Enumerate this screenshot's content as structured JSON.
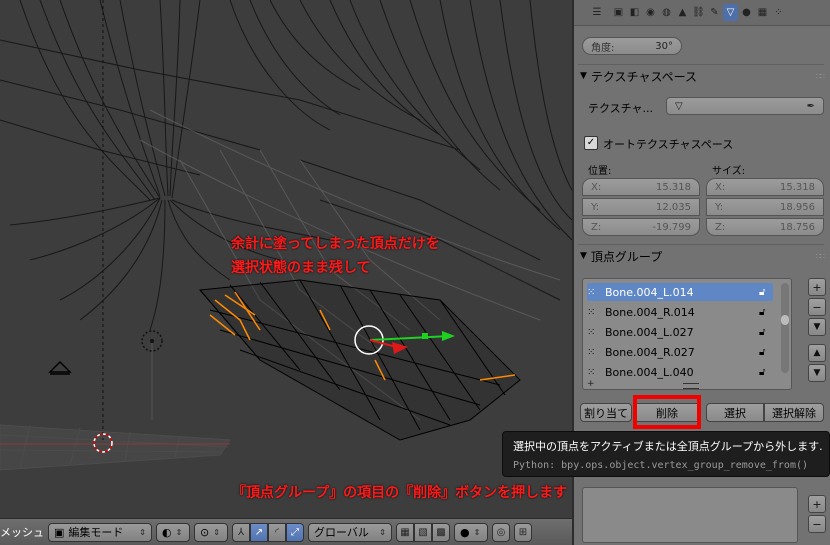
{
  "viewport": {
    "annotation_top_line1": "余計に塗ってしまった頂点だけを",
    "annotation_top_line2": "選択状態のまま残して",
    "annotation_bottom": "『頂点グループ』の項目の『削除』ボタンを押します"
  },
  "header": {
    "mesh_label": "メッシュ",
    "mode_label": "編集モード",
    "orientation_label": "グローバル"
  },
  "props": {
    "angle_label": "角度:",
    "angle_value": "30°",
    "texspace_title": "テクスチャスペース",
    "texture_label": "テクスチャ...",
    "auto_texspace_label": "オートテクスチャスペース",
    "location_label": "位置:",
    "size_label": "サイズ:",
    "loc_x_label": "X:",
    "loc_x_value": "15.318",
    "loc_y_label": "Y:",
    "loc_y_value": "12.035",
    "loc_z_label": "Z:",
    "loc_z_value": "-19.799",
    "size_x_label": "X:",
    "size_x_value": "15.318",
    "size_y_label": "Y:",
    "size_y_value": "18.956",
    "size_z_label": "Z:",
    "size_z_value": "18.756",
    "vgroups_title": "頂点グループ",
    "vertex_groups": [
      {
        "name": "Bone.004_L.014",
        "selected": true
      },
      {
        "name": "Bone.004_R.014",
        "selected": false
      },
      {
        "name": "Bone.004_L.027",
        "selected": false
      },
      {
        "name": "Bone.004_R.027",
        "selected": false
      },
      {
        "name": "Bone.004_L.040",
        "selected": false
      }
    ],
    "assign_label": "割り当て",
    "remove_label": "削除",
    "select_label": "選択",
    "deselect_label": "選択解除"
  },
  "tooltip": {
    "text": "選択中の頂点をアクティブまたは全頂点グループから外します.",
    "python": "Python: bpy.ops.object.vertex_group_remove_from()"
  },
  "colors": {
    "annotation_red": "#ff1a1a",
    "selection_blue": "#5f86c5",
    "active_vertex_orange": "#ff8a00"
  }
}
